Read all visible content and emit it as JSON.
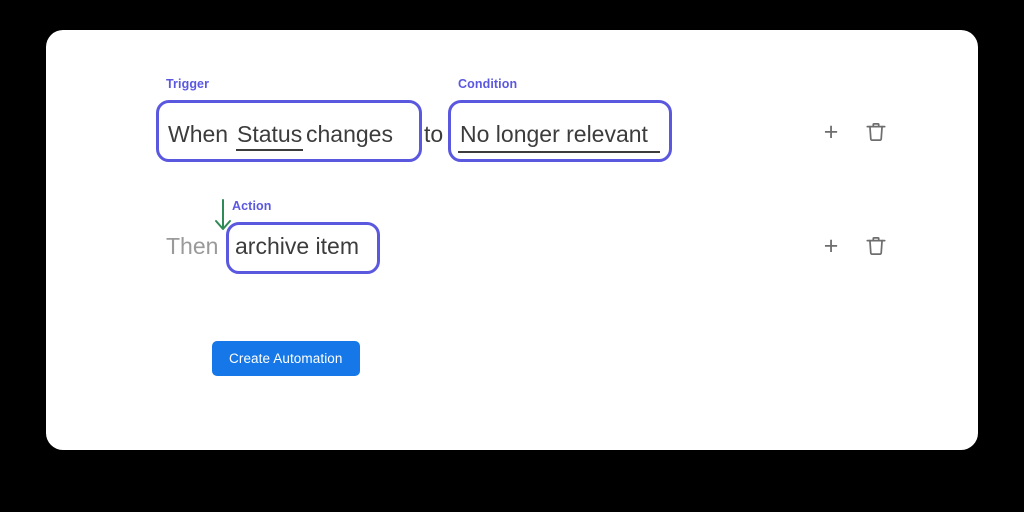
{
  "canvas": {
    "background": "#000000"
  },
  "card": {
    "background": "#ffffff"
  },
  "theme": {
    "accent_purple": "#5b58e0",
    "button_blue": "#1678e8",
    "arrow_green": "#2e8b57",
    "text_dark": "#3c3c3c",
    "text_muted": "#9a9a9a",
    "icon_gray": "#6e6e6e"
  },
  "rules": [
    {
      "trigger": {
        "label": "Trigger",
        "prefix": "When ",
        "token": "Status",
        "suffix": " changes"
      },
      "connector": "to",
      "condition": {
        "label": "Condition",
        "value": "No longer relevant"
      },
      "icons": {
        "add": "plus-icon",
        "add_glyph": "+",
        "delete": "trash-icon"
      }
    },
    {
      "action": {
        "label": "Action",
        "prefix": "Then",
        "value": "archive item"
      },
      "icons": {
        "add": "plus-icon",
        "add_glyph": "+",
        "delete": "trash-icon"
      }
    }
  ],
  "flow": {
    "arrow_icon": "arrow-down-icon"
  },
  "footer": {
    "create_button_label": "Create Automation"
  }
}
